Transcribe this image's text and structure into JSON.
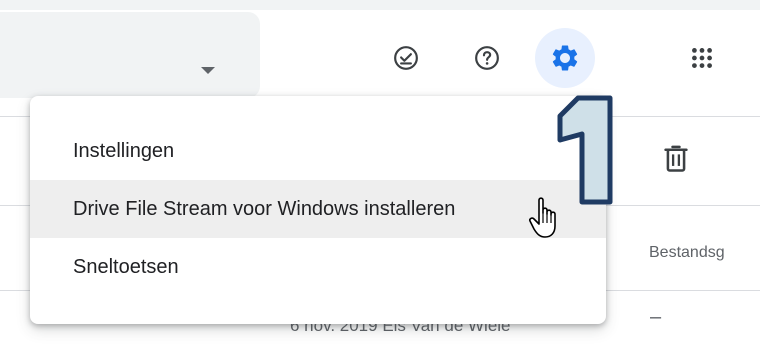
{
  "toolbar": {
    "search_dropdown_icon": "caret-down-icon",
    "buttons": [
      {
        "name": "offline-ready-icon",
        "icon": "check-circle"
      },
      {
        "name": "help-icon",
        "icon": "question-circle"
      },
      {
        "name": "settings-icon",
        "icon": "gear",
        "active": true
      },
      {
        "name": "apps-grid-icon",
        "icon": "grid"
      }
    ]
  },
  "table": {
    "column_header_size": "Bestandsg",
    "row_partial": "6 nov. 2019  Els Van de Wiele",
    "row_size_dash": "–"
  },
  "menu": {
    "items": [
      {
        "label": "Instellingen"
      },
      {
        "label": "Drive File Stream voor Windows installeren"
      },
      {
        "label": "Sneltoetsen"
      }
    ]
  },
  "annotation": {
    "step_number": "1"
  },
  "colors": {
    "accent": "#1a73e8",
    "active_bg": "#e8f0fe",
    "icon_gray": "#5f6368",
    "badge_fill": "#cfe0e8",
    "badge_stroke": "#1f3b63"
  }
}
